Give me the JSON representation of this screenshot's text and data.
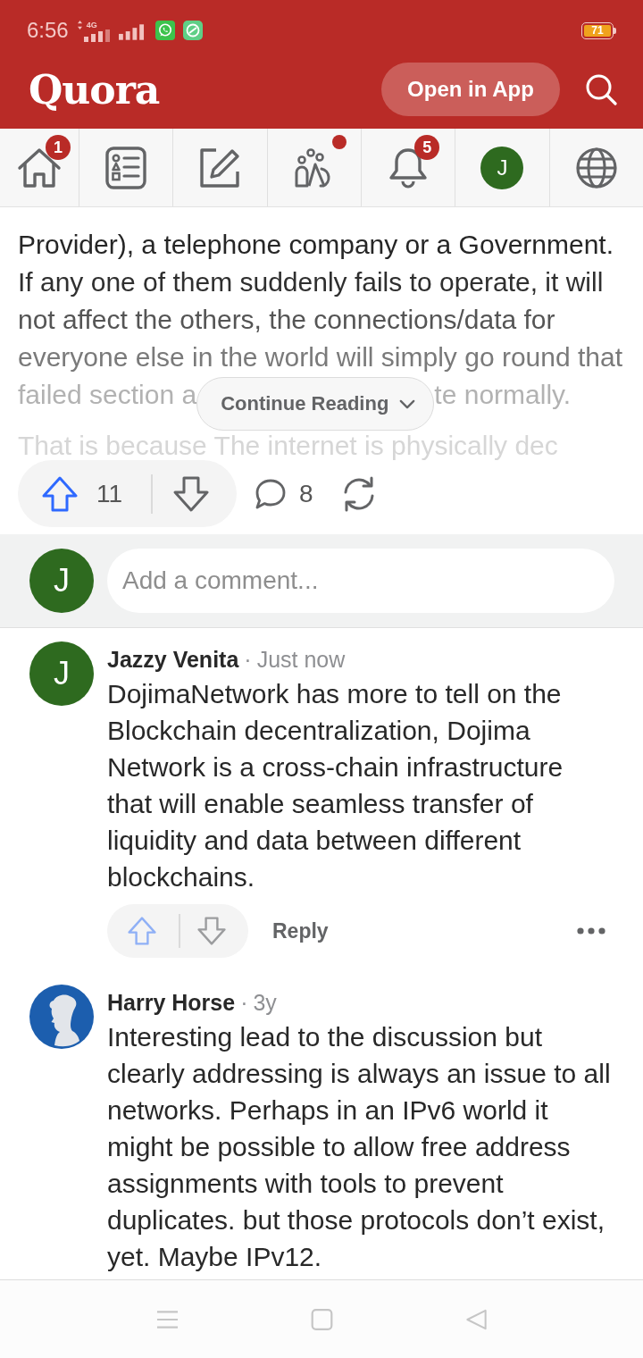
{
  "status_bar": {
    "time": "6:56",
    "network_type": "4G",
    "battery": "71"
  },
  "header": {
    "logo": "Quora",
    "open_app_button": "Open in App"
  },
  "nav_tabs": [
    {
      "kind": "home",
      "badge": "1",
      "dot": false
    },
    {
      "kind": "answer",
      "dot": false
    },
    {
      "kind": "write",
      "dot": false
    },
    {
      "kind": "spaces",
      "dot": true
    },
    {
      "kind": "notifications",
      "badge": "5",
      "dot": false
    },
    {
      "kind": "profile",
      "avatar_letter": "J",
      "dot": false
    },
    {
      "kind": "language",
      "dot": false
    }
  ],
  "answer": {
    "lines": [
      "Provider), a telephone company or a Government.",
      "If any one of them suddenly fails to operate, it will",
      "not affect the others, the connections/data for",
      "everyone else in the world will simply go round that"
    ],
    "cut_line_start": "failed section a",
    "continue_button": "Continue Reading",
    "cut_line_end": "te normally.",
    "last_line": "That is because The internet is physically dec"
  },
  "actions": {
    "upvotes": "11",
    "comments": "8"
  },
  "comment_box": {
    "avatar_letter": "J",
    "placeholder": "Add a comment..."
  },
  "comments": [
    {
      "author": "Jazzy Venita",
      "separator": "·",
      "time": "Just now",
      "avatar": {
        "kind": "letter",
        "letter": "J"
      },
      "lines": [
        "DojimaNetwork has more to tell on the",
        "Blockchain decentralization, Dojima",
        "Network is a cross-chain infrastructure",
        "that will enable seamless transfer of",
        "liquidity and data between different",
        "blockchains."
      ],
      "reply_button": "Reply"
    },
    {
      "author": "Harry Horse",
      "separator": "·",
      "time": "3y",
      "avatar": {
        "kind": "silhouette"
      },
      "lines": [
        "Interesting lead to the discussion but",
        "clearly addressing is always an issue to all",
        "networks. Perhaps in an IPv6 world it",
        "might be possible to allow free address",
        "assignments with tools to prevent",
        "duplicates. but those protocols don’t exist,",
        "yet. Maybe IPv12."
      ]
    }
  ]
}
